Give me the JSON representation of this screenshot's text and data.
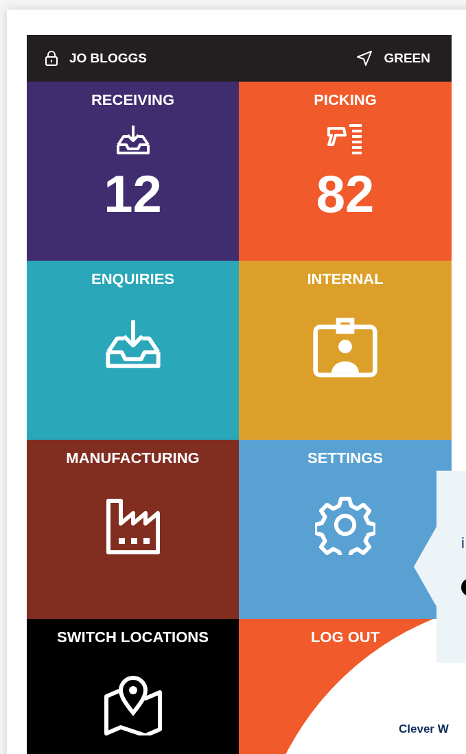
{
  "header": {
    "user": "JO BLOGGS",
    "location": "GREEN"
  },
  "tiles": [
    {
      "label": "RECEIVING",
      "kind": "count",
      "count": "12",
      "color": "#402d70"
    },
    {
      "label": "PICKING",
      "kind": "count",
      "count": "82",
      "color": "#f15a2b"
    },
    {
      "label": "ENQUIRIES",
      "kind": "icon",
      "color": "#2aa7b9"
    },
    {
      "label": "INTERNAL",
      "kind": "icon",
      "color": "#dca02a"
    },
    {
      "label": "MANUFACTURING",
      "kind": "icon",
      "color": "#812d20"
    },
    {
      "label": "SETTINGS",
      "kind": "icon",
      "color": "#5aa1d3"
    },
    {
      "label": "SWITCH LOCATIONS",
      "kind": "icon",
      "color": "#000000"
    },
    {
      "label": "LOG OUT",
      "kind": "icon",
      "color": "#f15a2b"
    }
  ],
  "popover": {
    "lines": [
      "i"
    ]
  },
  "brand_text": "Clever W"
}
